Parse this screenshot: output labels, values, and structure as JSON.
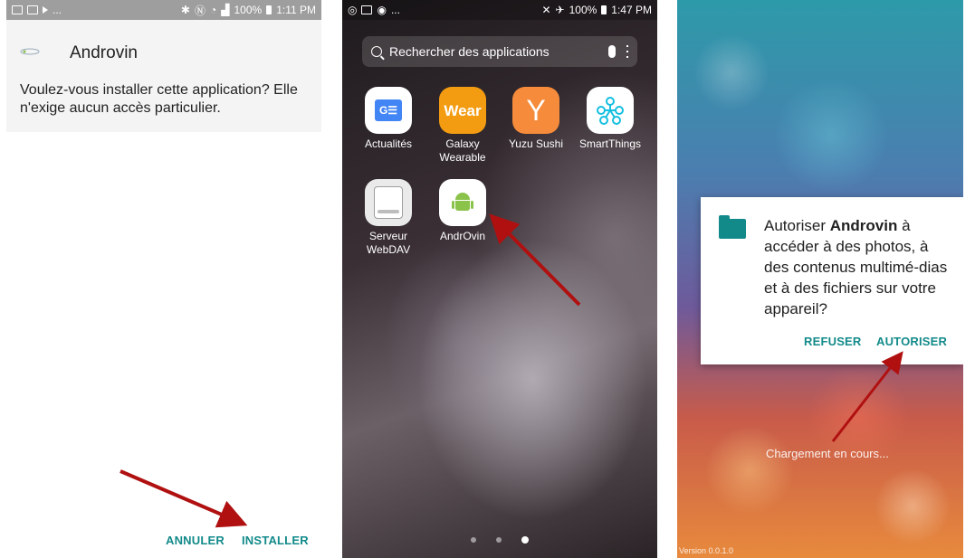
{
  "phone1": {
    "status_time": "1:11 PM",
    "status_battery": "100%",
    "status_dots": "...",
    "app_name": "Androvin",
    "install_question": "Voulez-vous installer cette application? Elle n'exige aucun accès particulier.",
    "cancel_label": "ANNULER",
    "install_label": "INSTALLER"
  },
  "phone2": {
    "status_time": "1:47 PM",
    "status_battery": "100%",
    "status_dots": "...",
    "search_placeholder": "Rechercher des applications",
    "apps": [
      {
        "label": "Actualités",
        "icon": "news-icon"
      },
      {
        "label": "Galaxy Wearable",
        "icon": "wear-icon",
        "icon_text": "Wear"
      },
      {
        "label": "Yuzu Sushi",
        "icon": "yuzu-icon",
        "icon_text": "Y"
      },
      {
        "label": "SmartThings",
        "icon": "smartthings-icon"
      },
      {
        "label": "Serveur WebDAV",
        "icon": "webdav-drive-icon"
      },
      {
        "label": "AndrOvin",
        "icon": "android-robot-icon"
      }
    ],
    "page_indicator": {
      "pages": 3,
      "active": 3
    }
  },
  "phone3": {
    "permission_prefix": "Autoriser ",
    "permission_app": "Androvin",
    "permission_rest": " à accéder à des photos, à des contenus multimé-dias et à des fichiers sur votre appareil?",
    "refuse_label": "REFUSER",
    "allow_label": "AUTORISER",
    "loading_text": "Chargement en cours...",
    "version_text": "Version 0.0.1.0"
  },
  "colors": {
    "accent_teal": "#138a8a",
    "arrow_red": "#b01010"
  }
}
